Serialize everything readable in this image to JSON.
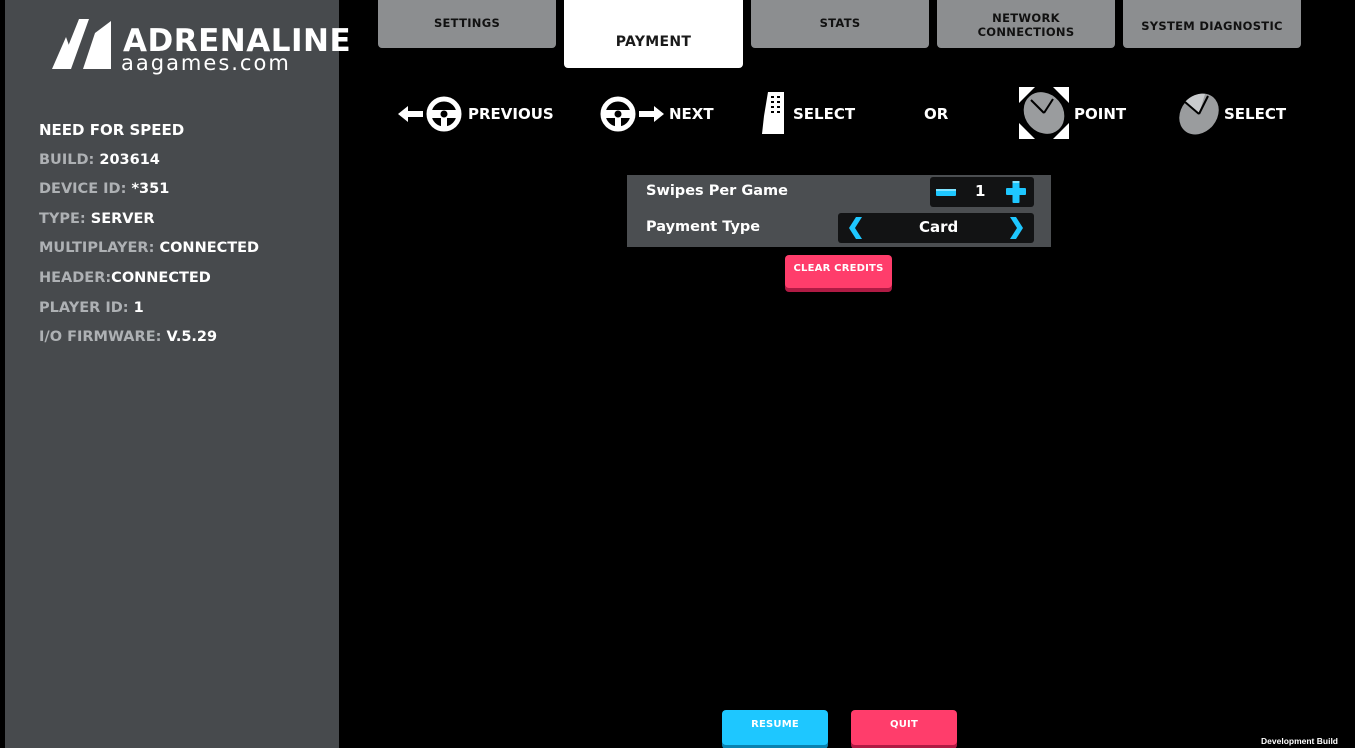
{
  "logo": {
    "brand": "ADRENALINE",
    "site": "aagames.com"
  },
  "info": {
    "game_title": "NEED FOR SPEED",
    "rows": [
      {
        "key": "BUILD:",
        "value": "203614"
      },
      {
        "key": "DEVICE ID:",
        "value": "*351"
      },
      {
        "key": "TYPE:",
        "value": "SERVER"
      },
      {
        "key": "MULTIPLAYER:",
        "value": "CONNECTED"
      },
      {
        "key": "HEADER:",
        "value": "CONNECTED"
      },
      {
        "key": "PLAYER ID:",
        "value": "1"
      },
      {
        "key": "I/O FIRMWARE:",
        "value": "V.5.29"
      }
    ]
  },
  "tabs": [
    {
      "label": "SETTINGS"
    },
    {
      "label": "PAYMENT",
      "active": true
    },
    {
      "label": "STATS"
    },
    {
      "label_line1": "NETWORK",
      "label_line2": "CONNECTIONS"
    },
    {
      "label": "SYSTEM DIAGNOSTIC"
    }
  ],
  "controls": {
    "previous": "PREVIOUS",
    "next": "NEXT",
    "select_pedal": "SELECT",
    "or": "OR",
    "point": "POINT",
    "select_mouse": "SELECT"
  },
  "settings": {
    "swipes_label": "Swipes Per Game",
    "swipes_value": "1",
    "payment_label": "Payment Type",
    "payment_value": "Card"
  },
  "buttons": {
    "clear_credits": "CLEAR CREDITS",
    "resume": "RESUME",
    "quit": "QUIT"
  },
  "footer": {
    "dev_build": "Development Build"
  },
  "colors": {
    "accent_blue": "#1ec7ff",
    "accent_pink": "#ff3d6b",
    "sidebar": "#474a4d",
    "tab": "#8c8e90"
  },
  "icons": [
    "steering-wheel-icon",
    "arrow-left-icon",
    "arrow-right-icon",
    "pedal-icon",
    "mouse-icon",
    "plus-icon",
    "minus-icon",
    "chevron-left-icon",
    "chevron-right-icon"
  ]
}
